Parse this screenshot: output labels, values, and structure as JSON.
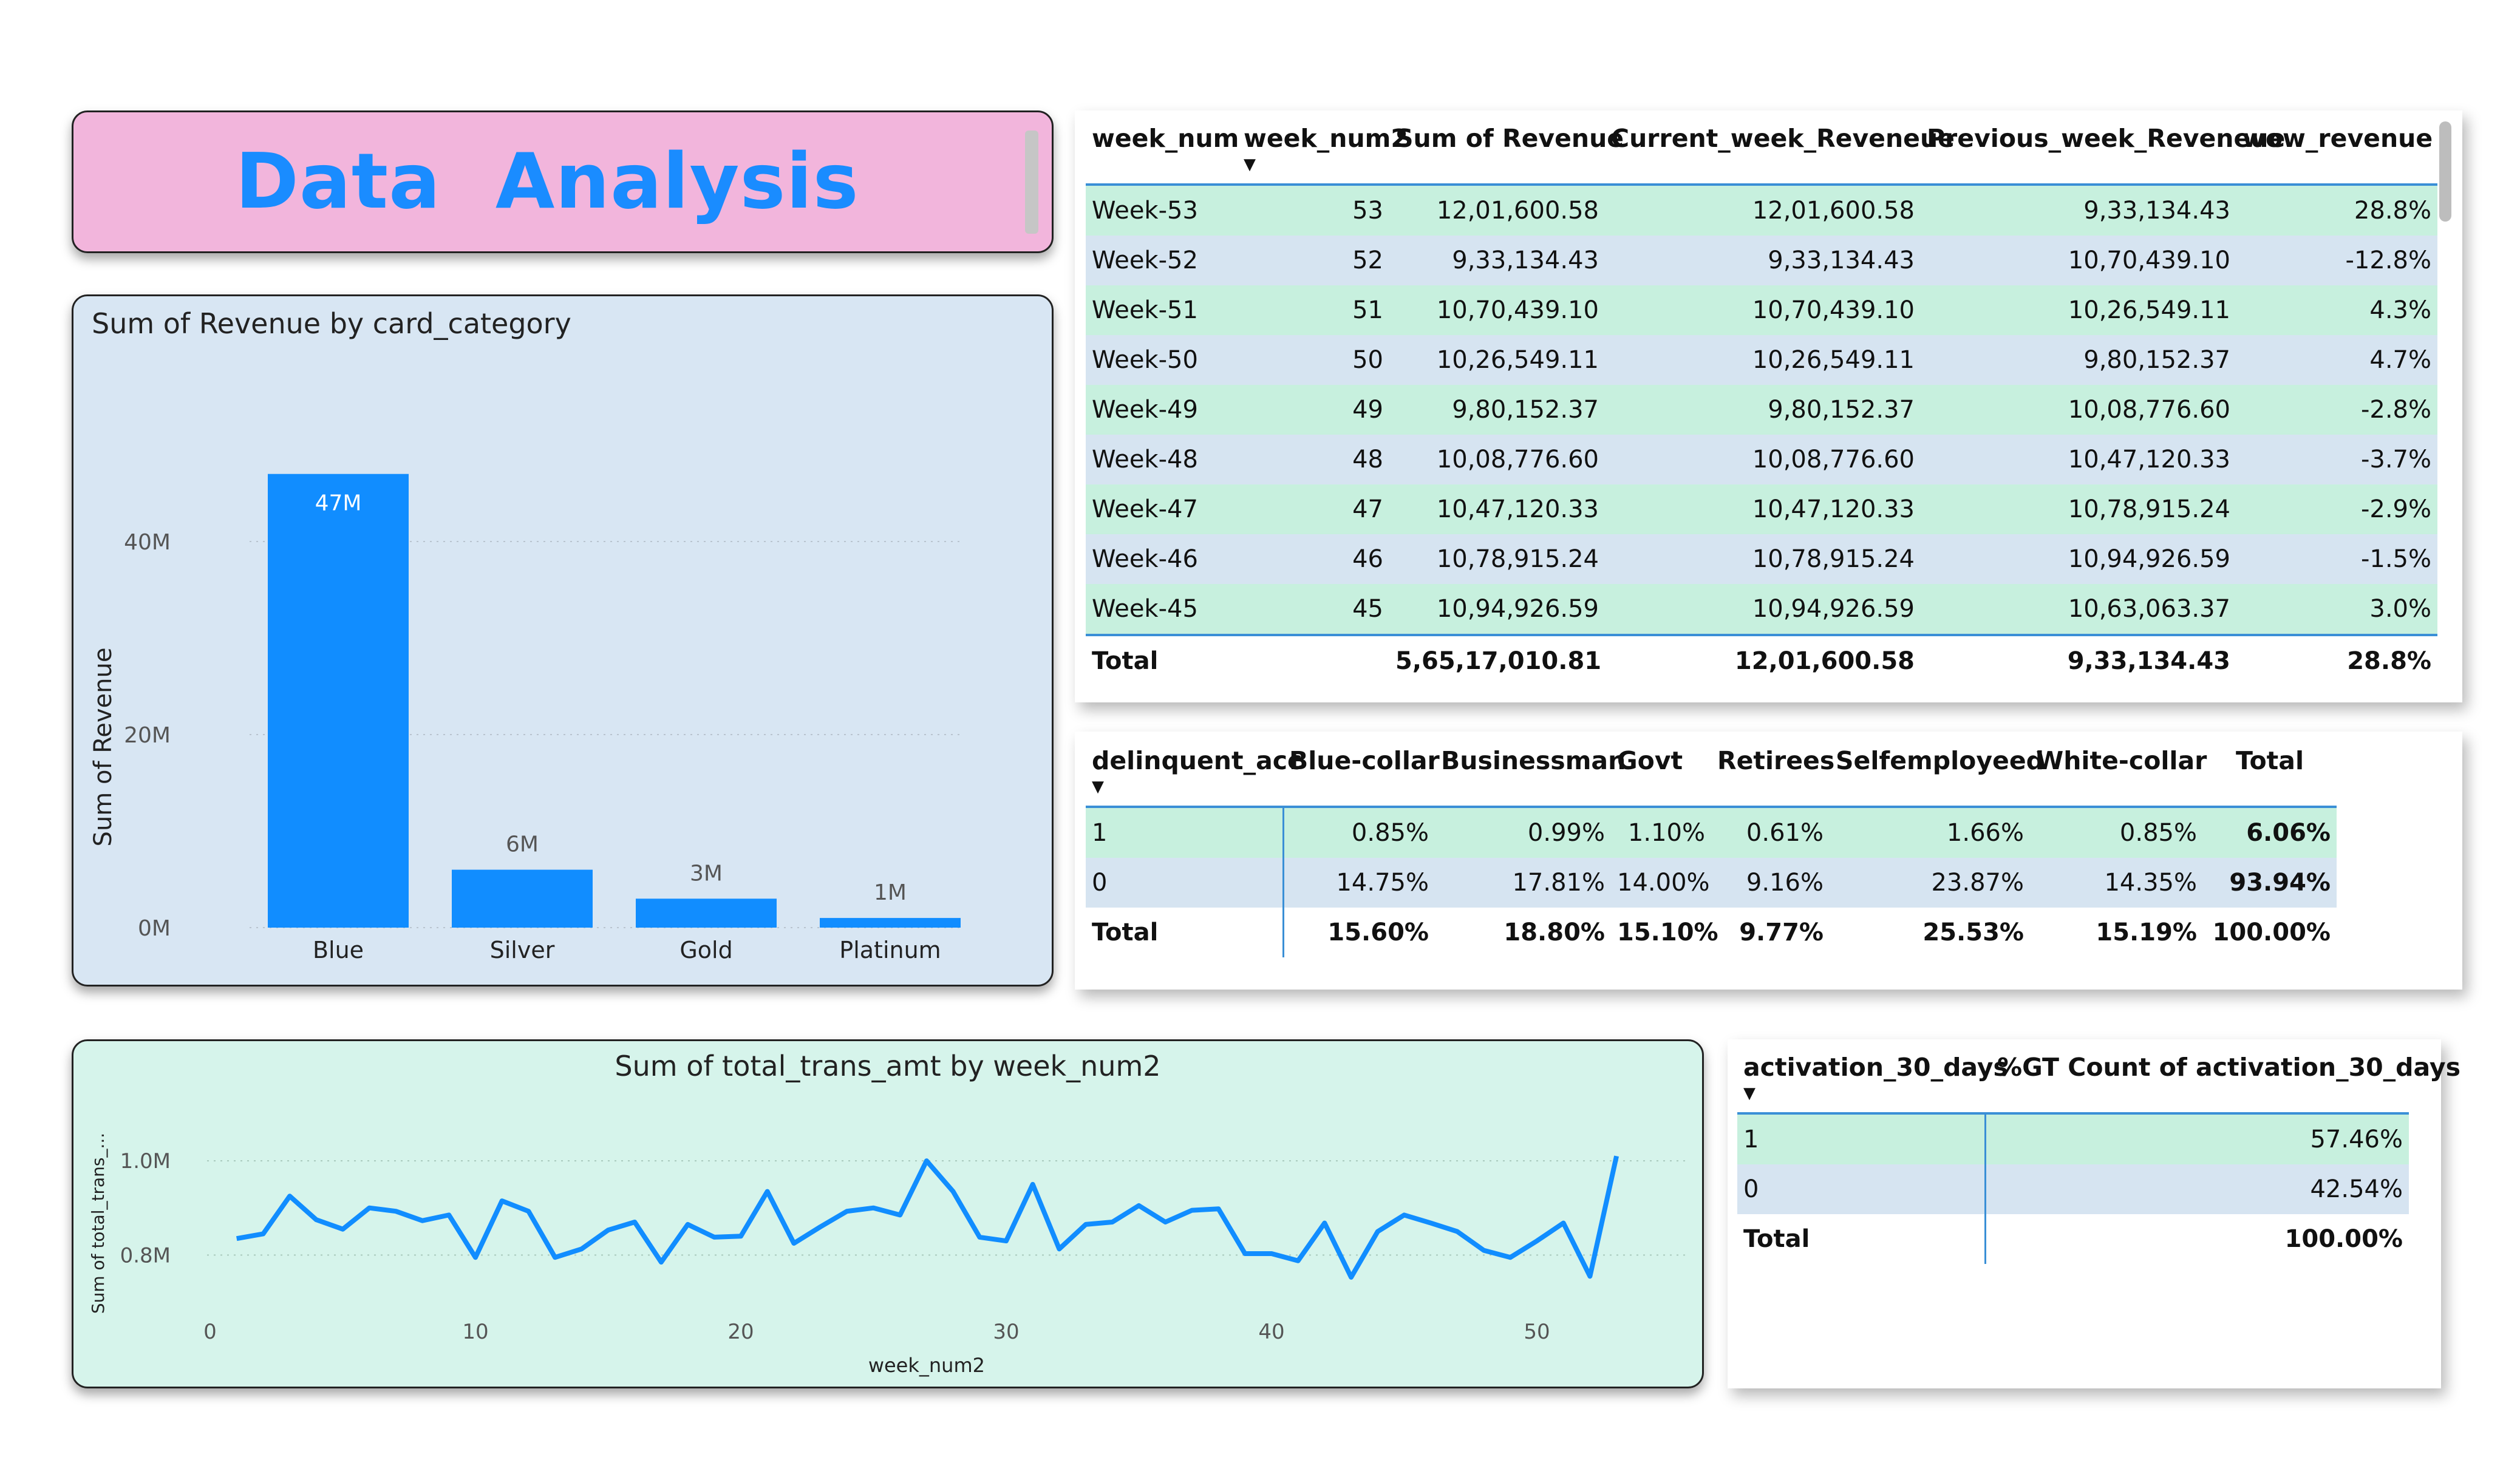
{
  "title": {
    "text": "Data  Analysis"
  },
  "revenue_table": {
    "columns": [
      "week_num",
      "week_num2",
      "Sum of Revenue",
      "Current_week_Reveneue",
      "Previous_week_Reveneue",
      "wow_revenue"
    ],
    "rows": [
      [
        "Week-53",
        "53",
        "12,01,600.58",
        "12,01,600.58",
        "9,33,134.43",
        "28.8%"
      ],
      [
        "Week-52",
        "52",
        "9,33,134.43",
        "9,33,134.43",
        "10,70,439.10",
        "-12.8%"
      ],
      [
        "Week-51",
        "51",
        "10,70,439.10",
        "10,70,439.10",
        "10,26,549.11",
        "4.3%"
      ],
      [
        "Week-50",
        "50",
        "10,26,549.11",
        "10,26,549.11",
        "9,80,152.37",
        "4.7%"
      ],
      [
        "Week-49",
        "49",
        "9,80,152.37",
        "9,80,152.37",
        "10,08,776.60",
        "-2.8%"
      ],
      [
        "Week-48",
        "48",
        "10,08,776.60",
        "10,08,776.60",
        "10,47,120.33",
        "-3.7%"
      ],
      [
        "Week-47",
        "47",
        "10,47,120.33",
        "10,47,120.33",
        "10,78,915.24",
        "-2.9%"
      ],
      [
        "Week-46",
        "46",
        "10,78,915.24",
        "10,78,915.24",
        "10,94,926.59",
        "-1.5%"
      ],
      [
        "Week-45",
        "45",
        "10,94,926.59",
        "10,94,926.59",
        "10,63,063.37",
        "3.0%"
      ]
    ],
    "total": [
      "Total",
      "",
      "5,65,17,010.81",
      "12,01,600.58",
      "9,33,134.43",
      "28.8%"
    ],
    "sort_icon": "sort-desc-icon"
  },
  "delinquent_table": {
    "columns": [
      "delinquent_acc",
      "Blue-collar",
      "Businessman",
      "Govt",
      "Retirees",
      "Selfemployeed",
      "White-collar",
      "Total"
    ],
    "rows": [
      [
        "1",
        "0.85%",
        "0.99%",
        "1.10%",
        "0.61%",
        "1.66%",
        "0.85%",
        "6.06%"
      ],
      [
        "0",
        "14.75%",
        "17.81%",
        "14.00%",
        "9.16%",
        "23.87%",
        "14.35%",
        "93.94%"
      ]
    ],
    "total": [
      "Total",
      "15.60%",
      "18.80%",
      "15.10%",
      "9.77%",
      "25.53%",
      "15.19%",
      "100.00%"
    ],
    "sort_icon": "sort-desc-icon"
  },
  "activation_table": {
    "columns": [
      "activation_30_days",
      "%GT Count of activation_30_days"
    ],
    "rows": [
      [
        "1",
        "57.46%"
      ],
      [
        "0",
        "42.54%"
      ]
    ],
    "total": [
      "Total",
      "100.00%"
    ],
    "sort_icon": "sort-desc-icon"
  },
  "chart_data": [
    {
      "type": "bar",
      "title": "Sum of Revenue by card_category",
      "xlabel": "",
      "ylabel": "Sum of Revenue",
      "categories": [
        "Blue",
        "Silver",
        "Gold",
        "Platinum"
      ],
      "values": [
        47,
        6,
        3,
        1
      ],
      "data_labels": [
        "47M",
        "6M",
        "3M",
        "1M"
      ],
      "ylim": [
        0,
        50
      ],
      "ticks": [
        0,
        20,
        40
      ],
      "tick_labels": [
        "0M",
        "20M",
        "40M"
      ],
      "grid": true,
      "bar_color": "#118dff"
    },
    {
      "type": "line",
      "title": "Sum of total_trans_amt by week_num2",
      "xlabel": "week_num2",
      "ylabel": "Sum of total_trans_...",
      "x": [
        1,
        2,
        3,
        4,
        5,
        6,
        7,
        8,
        9,
        10,
        11,
        12,
        13,
        14,
        15,
        16,
        17,
        18,
        19,
        20,
        21,
        22,
        23,
        24,
        25,
        26,
        27,
        28,
        29,
        30,
        31,
        32,
        33,
        34,
        35,
        36,
        37,
        38,
        39,
        40,
        41,
        42,
        43,
        44,
        45,
        46,
        47,
        48,
        49,
        50,
        51,
        52,
        53
      ],
      "values": [
        0.835,
        0.845,
        0.925,
        0.875,
        0.855,
        0.9,
        0.893,
        0.873,
        0.885,
        0.795,
        0.915,
        0.893,
        0.795,
        0.813,
        0.853,
        0.87,
        0.785,
        0.865,
        0.838,
        0.84,
        0.935,
        0.825,
        0.86,
        0.893,
        0.9,
        0.885,
        1.0,
        0.935,
        0.838,
        0.83,
        0.95,
        0.813,
        0.865,
        0.87,
        0.905,
        0.87,
        0.895,
        0.898,
        0.803,
        0.803,
        0.788,
        0.868,
        0.753,
        0.85,
        0.885,
        0.868,
        0.85,
        0.81,
        0.795,
        0.83,
        0.868,
        0.755,
        1.01
      ],
      "xlim": [
        0,
        53
      ],
      "ylim": [
        0.7,
        1.08
      ],
      "x_ticks": [
        0,
        10,
        20,
        30,
        40,
        50
      ],
      "x_tick_labels": [
        "0",
        "10",
        "20",
        "30",
        "40",
        "50"
      ],
      "y_ticks": [
        0.8,
        1.0
      ],
      "y_tick_labels": [
        "0.8M",
        "1.0M"
      ],
      "grid": true,
      "line_color": "#118dff"
    }
  ]
}
